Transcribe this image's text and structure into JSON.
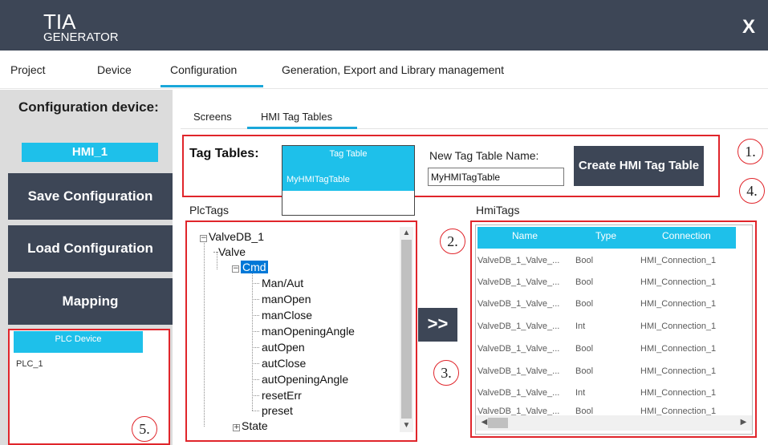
{
  "app": {
    "title_main": "TIA",
    "title_sub": "GENERATOR",
    "close_label": "X"
  },
  "menu": {
    "items": [
      "Project",
      "Device",
      "Configuration",
      "Generation, Export and Library management"
    ],
    "active": "Configuration"
  },
  "sidebar": {
    "config_label": "Configuration device:",
    "device_name": "HMI_1",
    "save_label": "Save Configuration",
    "load_label": "Load Configuration",
    "mapping_label": "Mapping",
    "plc_header": "PLC Device",
    "plc_items": [
      "PLC_1"
    ]
  },
  "subtabs": {
    "items": [
      "Screens",
      "HMI Tag Tables"
    ],
    "active": "HMI Tag Tables"
  },
  "tag_tables": {
    "label": "Tag Tables:",
    "list_header": "Tag Table",
    "list_items": [
      "MyHMITagTable"
    ],
    "new_name_label": "New Tag Table Name:",
    "new_name_value": "MyHMITagTable",
    "create_label": "Create HMI Tag Table"
  },
  "plc_tags": {
    "label": "PlcTags",
    "tree": {
      "root": "ValveDB_1",
      "child": "Valve",
      "selected": "Cmd",
      "leaves": [
        "Man/Aut",
        "manOpen",
        "manClose",
        "manOpeningAngle",
        "autOpen",
        "autClose",
        "autOpeningAngle",
        "resetErr",
        "preset"
      ],
      "sibling": "State"
    }
  },
  "transfer": {
    "label": ">>"
  },
  "hmi_tags": {
    "label": "HmiTags",
    "columns": [
      "Name",
      "Type",
      "Connection"
    ],
    "rows": [
      [
        "ValveDB_1_Valve_...",
        "Bool",
        "HMI_Connection_1"
      ],
      [
        "ValveDB_1_Valve_...",
        "Bool",
        "HMI_Connection_1"
      ],
      [
        "ValveDB_1_Valve_...",
        "Bool",
        "HMI_Connection_1"
      ],
      [
        "ValveDB_1_Valve_...",
        "Int",
        "HMI_Connection_1"
      ],
      [
        "ValveDB_1_Valve_...",
        "Bool",
        "HMI_Connection_1"
      ],
      [
        "ValveDB_1_Valve_...",
        "Bool",
        "HMI_Connection_1"
      ],
      [
        "ValveDB_1_Valve_...",
        "Int",
        "HMI_Connection_1"
      ],
      [
        "ValveDB_1_Valve_...",
        "Bool",
        "HMI_Connection_1"
      ]
    ]
  },
  "callouts": [
    "1.",
    "2.",
    "3.",
    "4.",
    "5."
  ],
  "colors": {
    "dark": "#3d4656",
    "accent": "#1ec0ea",
    "highlight": "#e0252b",
    "selection": "#0078d7"
  },
  "icons": [
    "close-icon",
    "tree-collapse-icon",
    "tree-expand-icon",
    "scroll-up-icon",
    "scroll-down-icon",
    "scroll-left-icon",
    "scroll-right-icon"
  ]
}
